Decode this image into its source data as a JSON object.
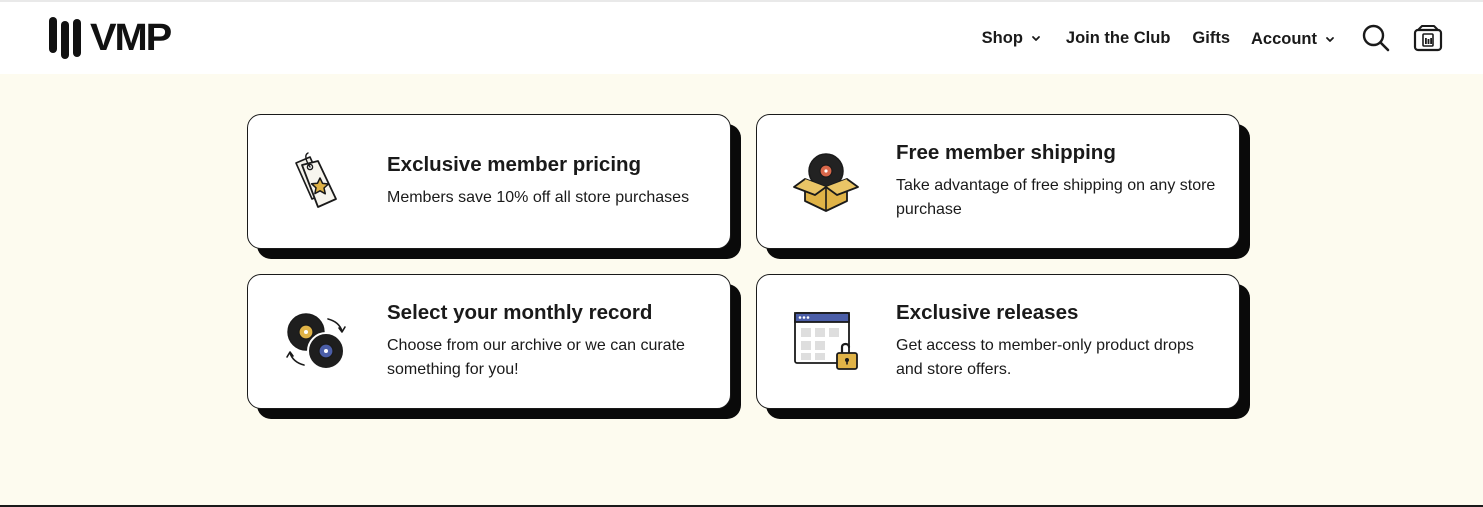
{
  "header": {
    "logo_text": "VMP",
    "nav": {
      "shop": "Shop",
      "join": "Join the Club",
      "gifts": "Gifts",
      "account": "Account"
    },
    "icons": [
      "chevron-down-icon",
      "search-icon",
      "cart-icon"
    ]
  },
  "benefits": [
    {
      "icon": "price-tag-star-icon",
      "title": "Exclusive member pricing",
      "description": "Members save 10% off all store purchases"
    },
    {
      "icon": "record-box-icon",
      "title": "Free member shipping",
      "description": "Take advantage of free shipping on any store purchase"
    },
    {
      "icon": "records-swap-icon",
      "title": "Select your monthly record",
      "description": "Choose from our archive or we can curate something for you!"
    },
    {
      "icon": "unlocked-window-icon",
      "title": "Exclusive releases",
      "description": "Get access to member-only product drops and store offers."
    }
  ],
  "colors": {
    "background": "#fdfbef",
    "header": "#ffffff",
    "text": "#1a1a1a",
    "accent_gold": "#e0b347",
    "accent_orange": "#d8674a",
    "accent_blue": "#4b5ea8"
  }
}
